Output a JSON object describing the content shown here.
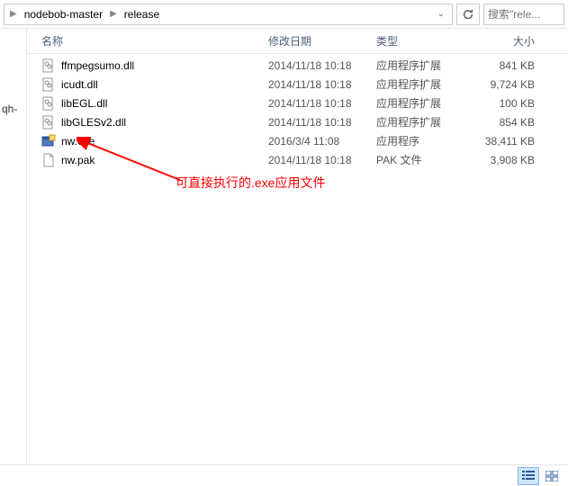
{
  "breadcrumb": {
    "items": [
      "nodebob-master",
      "release"
    ]
  },
  "search": {
    "placeholder": "搜索\"rele..."
  },
  "sidebar": {
    "items": [
      {
        "label": ""
      },
      {
        "label": ""
      },
      {
        "label": ""
      },
      {
        "label": "qh-"
      }
    ]
  },
  "columns": {
    "name": "名称",
    "date": "修改日期",
    "type": "类型",
    "size": "大小"
  },
  "files": [
    {
      "name": "ffmpegsumo.dll",
      "date": "2014/11/18 10:18",
      "type": "应用程序扩展",
      "size": "841 KB",
      "icon": "dll"
    },
    {
      "name": "icudt.dll",
      "date": "2014/11/18 10:18",
      "type": "应用程序扩展",
      "size": "9,724 KB",
      "icon": "dll"
    },
    {
      "name": "libEGL.dll",
      "date": "2014/11/18 10:18",
      "type": "应用程序扩展",
      "size": "100 KB",
      "icon": "dll"
    },
    {
      "name": "libGLESv2.dll",
      "date": "2014/11/18 10:18",
      "type": "应用程序扩展",
      "size": "854 KB",
      "icon": "dll"
    },
    {
      "name": "nw.exe",
      "date": "2016/3/4 11:08",
      "type": "应用程序",
      "size": "38,411 KB",
      "icon": "exe"
    },
    {
      "name": "nw.pak",
      "date": "2014/11/18 10:18",
      "type": "PAK 文件",
      "size": "3,908 KB",
      "icon": "file"
    }
  ],
  "annotation": {
    "text": "可直接执行的.exe应用文件"
  }
}
